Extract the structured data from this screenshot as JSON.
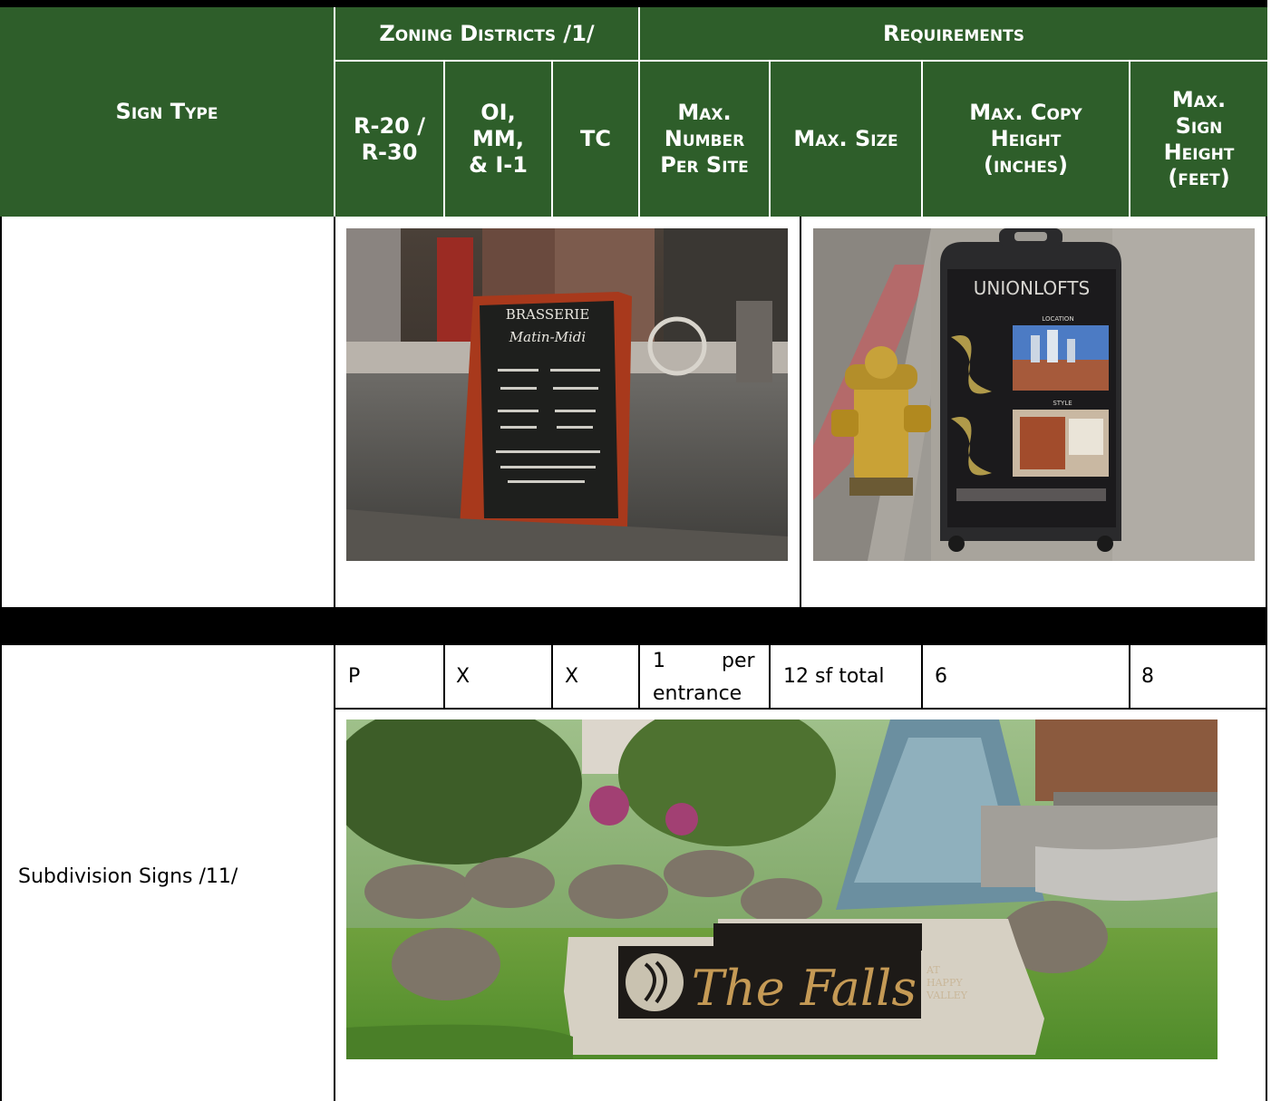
{
  "header": {
    "sign_type": "Sign Type",
    "zoning_districts": "Zoning Districts /1/",
    "requirements": "Requirements",
    "col_r20_line1": "R-20 /",
    "col_r20_line2": "R-30",
    "col_oi_line1": "OI,",
    "col_oi_line2": "MM,",
    "col_oi_line3": "& I-1",
    "col_tc": "TC",
    "max_number_line1": "Max.",
    "max_number_line2": "Number",
    "max_number_line3": "Per Site",
    "max_size": "Max. Size",
    "max_copy_line1": "Max. Copy",
    "max_copy_line2": "Height",
    "max_copy_line3": "(inches)",
    "max_sign_line1": "Max.",
    "max_sign_line2": "Sign",
    "max_sign_line3": "Height",
    "max_sign_line4": "(feet)"
  },
  "images": {
    "aframe_text": [
      "BRASSERIE",
      "Matin-Midi"
    ],
    "sandwich_text": [
      "UNIONLOFTS",
      "LOCATION",
      "STYLE"
    ],
    "monument_text": [
      "The Falls",
      "AT",
      "HAPPY",
      "VALLEY"
    ]
  },
  "rows": [
    {
      "sign_type": "Subdivision Signs /11/",
      "r20_r30": "P",
      "oi_mm_i1": "X",
      "tc": "X",
      "max_number_line1": "1",
      "max_number_word": "per",
      "max_number_line2": "entrance",
      "max_size": "12 sf total",
      "max_copy_height": "6",
      "max_sign_height": "8"
    }
  ],
  "colors": {
    "header_green": "#2e5e2a",
    "header_text": "#ffffff",
    "separator": "#000000"
  }
}
